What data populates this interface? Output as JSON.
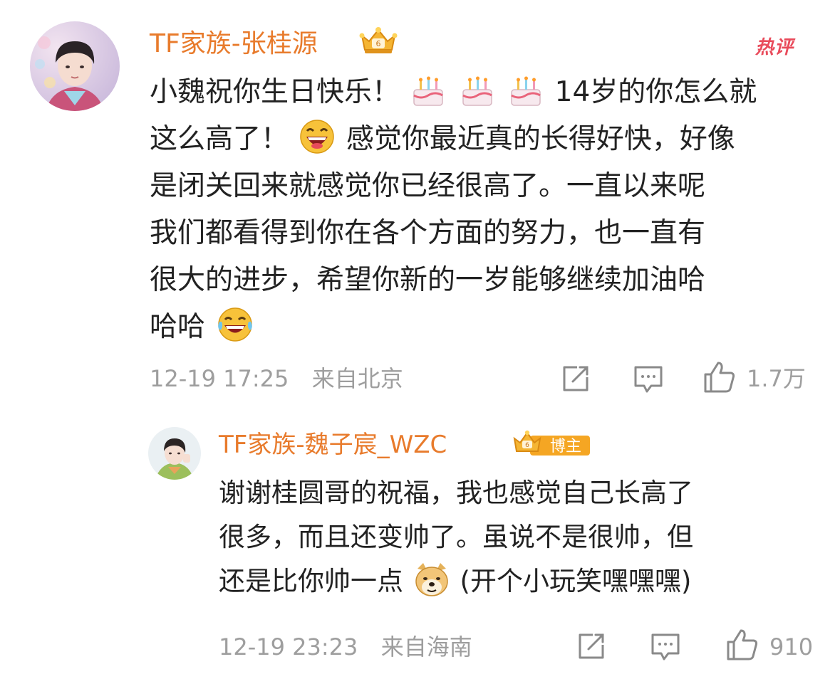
{
  "comment": {
    "username": "TF家族-张桂源",
    "hot_tag": "热评",
    "lines": [
      "小魏祝你生日快乐！",
      "14岁的你怎么就",
      "这么高了！",
      "感觉你最近真的长得好快，好像",
      "是闭关回来就感觉你已经很高了。一直以来呢",
      "我们都看得到你在各个方面的努力，也一直有",
      "很大的进步，希望你新的一岁能够继续加油哈",
      "哈哈"
    ],
    "timestamp": "12-19 17:25",
    "location": "来自北京",
    "likes": "1.7万",
    "emojis": [
      "cake-emoji",
      "cake-emoji",
      "cake-emoji",
      "grin-emoji",
      "laugh-tears-emoji"
    ],
    "icons": [
      "share-icon",
      "comment-icon",
      "like-icon"
    ]
  },
  "reply": {
    "username": "TF家族-魏子宸_WZC",
    "badge_label": "博主",
    "lines": [
      "谢谢桂圆哥的祝福，我也感觉自己长高了",
      "很多，而且还变帅了。虽说不是很帅，但",
      "还是比你帅一点",
      "(开个小玩笑嘿嘿嘿)"
    ],
    "timestamp": "12-19 23:23",
    "location": "来自海南",
    "likes": "910",
    "emojis": [
      "doge-emoji"
    ],
    "icons": [
      "share-icon",
      "comment-icon",
      "like-icon"
    ]
  },
  "colors": {
    "username": "#e87b2c",
    "hot_tag": "#e94b5b",
    "text": "#222222",
    "meta": "#9e9e9e"
  }
}
